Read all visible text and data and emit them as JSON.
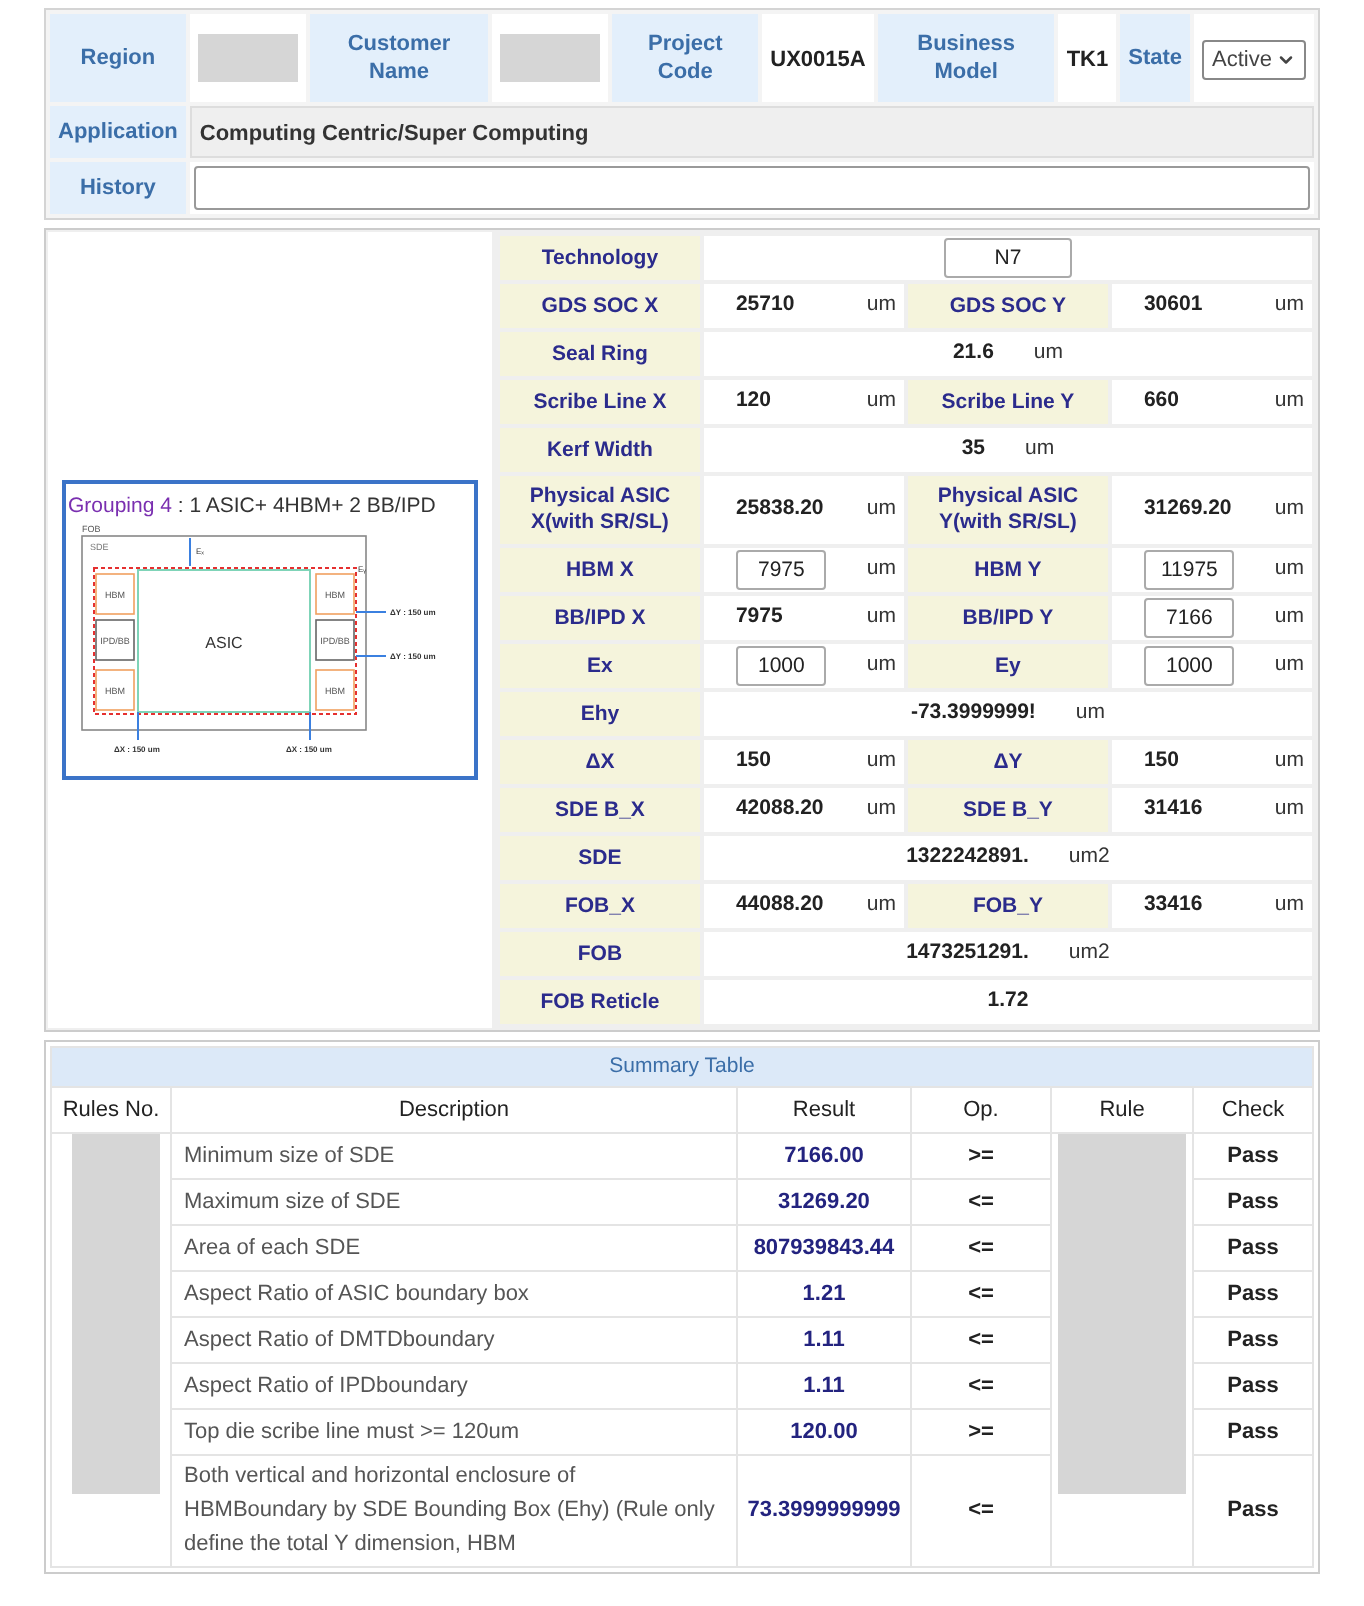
{
  "header": {
    "fields": [
      {
        "label": "Region",
        "kind": "redacted"
      },
      {
        "label": "Customer Name",
        "kind": "redacted"
      },
      {
        "label": "Project Code",
        "kind": "text",
        "value": "UX0015A"
      },
      {
        "label": "Business Model",
        "kind": "text",
        "value": "TK1"
      },
      {
        "label": "State",
        "kind": "select",
        "value": "Active"
      }
    ],
    "application": {
      "label": "Application",
      "value": "Computing Centric/Super Computing"
    },
    "history": {
      "label": "History"
    }
  },
  "diagram": {
    "title_lead": "Grouping 4",
    "title_rest": " : 1 ASIC+ 4HBM+ 2 BB/IPD",
    "fob": "FOB",
    "sde": "SDE",
    "asic": "ASIC",
    "left_blocks": [
      "HBM",
      "IPD/BB",
      "HBM"
    ],
    "right_blocks": [
      "HBM",
      "IPD/BB",
      "HBM"
    ],
    "ex": "Eₓ",
    "ey": "Eᵧ",
    "dy_labels": [
      "ΔY : 150 um",
      "ΔY : 150 um"
    ],
    "dx_labels": [
      "ΔX : 150 um",
      "ΔX : 150 um"
    ]
  },
  "parameters": [
    {
      "cells": [
        {
          "label": "Technology",
          "value": "N7",
          "kind": "input"
        }
      ]
    },
    {
      "cells": [
        {
          "label": "GDS SOC X",
          "value": "25710",
          "unit": "um",
          "kind": "text"
        },
        {
          "label": "GDS SOC Y",
          "value": "30601",
          "unit": "um",
          "kind": "text"
        }
      ]
    },
    {
      "cells": [
        {
          "label": "Seal Ring",
          "value": "21.6",
          "unit": "um",
          "kind": "text"
        }
      ]
    },
    {
      "cells": [
        {
          "label": "Scribe Line X",
          "value": "120",
          "unit": "um",
          "kind": "text"
        },
        {
          "label": "Scribe Line Y",
          "value": "660",
          "unit": "um",
          "kind": "text"
        }
      ]
    },
    {
      "cells": [
        {
          "label": "Kerf Width",
          "value": "35",
          "unit": "um",
          "kind": "text"
        }
      ]
    },
    {
      "cells": [
        {
          "label": "Physical ASIC X(with SR/SL)",
          "value": "25838.20",
          "unit": "um",
          "kind": "text"
        },
        {
          "label": "Physical ASIC Y(with SR/SL)",
          "value": "31269.20",
          "unit": "um",
          "kind": "text"
        }
      ]
    },
    {
      "cells": [
        {
          "label": "HBM X",
          "value": "7975",
          "unit": "um",
          "kind": "input"
        },
        {
          "label": "HBM Y",
          "value": "11975",
          "unit": "um",
          "kind": "input"
        }
      ]
    },
    {
      "cells": [
        {
          "label": "BB/IPD X",
          "value": "7975",
          "unit": "um",
          "kind": "text"
        },
        {
          "label": "BB/IPD Y",
          "value": "7166",
          "unit": "um",
          "kind": "input"
        }
      ]
    },
    {
      "cells": [
        {
          "label": "Ex",
          "value": "1000",
          "unit": "um",
          "kind": "input"
        },
        {
          "label": "Ey",
          "value": "1000",
          "unit": "um",
          "kind": "input"
        }
      ]
    },
    {
      "cells": [
        {
          "label": "Ehy",
          "value": "-73.3999999!",
          "unit": "um",
          "kind": "text"
        }
      ]
    },
    {
      "cells": [
        {
          "label": "ΔX",
          "value": "150",
          "unit": "um",
          "kind": "text"
        },
        {
          "label": "ΔY",
          "value": "150",
          "unit": "um",
          "kind": "text"
        }
      ]
    },
    {
      "cells": [
        {
          "label": "SDE B_X",
          "value": "42088.20",
          "unit": "um",
          "kind": "text"
        },
        {
          "label": "SDE B_Y",
          "value": "31416",
          "unit": "um",
          "kind": "text"
        }
      ]
    },
    {
      "cells": [
        {
          "label": "SDE",
          "value": "1322242891.",
          "unit": "um2",
          "kind": "text"
        }
      ]
    },
    {
      "cells": [
        {
          "label": "FOB_X",
          "value": "44088.20",
          "unit": "um",
          "kind": "text"
        },
        {
          "label": "FOB_Y",
          "value": "33416",
          "unit": "um",
          "kind": "text"
        }
      ]
    },
    {
      "cells": [
        {
          "label": "FOB",
          "value": "1473251291.",
          "unit": "um2",
          "kind": "text"
        }
      ]
    },
    {
      "cells": [
        {
          "label": "FOB Reticle",
          "value": "1.72",
          "kind": "text"
        }
      ]
    }
  ],
  "summary": {
    "title": "Summary Table",
    "columns": [
      "Rules No.",
      "Description",
      "Result",
      "Op.",
      "Rule",
      "Check"
    ],
    "rows": [
      {
        "description": "Minimum size of SDE",
        "result": "7166.00",
        "op": ">=",
        "check": "Pass"
      },
      {
        "description": "Maximum size of SDE",
        "result": "31269.20",
        "op": "<=",
        "check": "Pass"
      },
      {
        "description": "Area of each SDE",
        "result": "807939843.44",
        "op": "<=",
        "check": "Pass"
      },
      {
        "description": "Aspect Ratio of ASIC boundary box",
        "result": "1.21",
        "op": "<=",
        "check": "Pass"
      },
      {
        "description": "Aspect Ratio of DMTDboundary",
        "result": "1.11",
        "op": "<=",
        "check": "Pass"
      },
      {
        "description": "Aspect Ratio of IPDboundary",
        "result": "1.11",
        "op": "<=",
        "check": "Pass"
      },
      {
        "description": "Top die scribe line must >= 120um",
        "result": "120.00",
        "op": ">=",
        "check": "Pass"
      },
      {
        "description": "Both vertical and horizontal enclosure of HBMBoundary by SDE Bounding Box (Ehy) (Rule only define the total Y dimension, HBM",
        "result": "73.3999999999",
        "op": "<=",
        "check": "Pass"
      }
    ]
  }
}
